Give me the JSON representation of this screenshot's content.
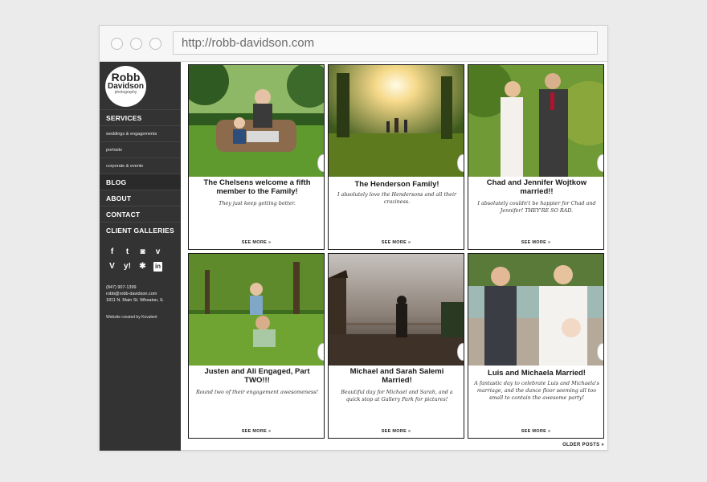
{
  "browser": {
    "url": "http://robb-davidson.com"
  },
  "logo": {
    "line1": "Robb",
    "line2": "Davidson",
    "line3": "photography"
  },
  "nav": {
    "services": "SERVICES",
    "sub1": "weddings & engagements",
    "sub2": "portraits",
    "sub3": "corporate & events",
    "blog": "BLOG",
    "about": "ABOUT",
    "contact": "CONTACT",
    "client": "CLIENT GALLERIES"
  },
  "social": {
    "icons": [
      "facebook-icon",
      "twitter-icon",
      "instagram-icon",
      "vimeo-icon",
      "vine-icon",
      "yelp-icon",
      "yelp-flower-icon",
      "linkedin-icon"
    ],
    "glyphs": {
      "facebook": "f",
      "twitter": "t",
      "instagram": "◙",
      "vimeo": "v",
      "vine": "V",
      "yelp": "y!",
      "flower": "✱",
      "linkedin": "in"
    }
  },
  "contact": {
    "phone": "(847) 907-1399",
    "email": "robb@robb-davidson.com",
    "address": "1811 N. Main St. Wheaton, IL",
    "credit": "Website created by Kovalent"
  },
  "posts": [
    {
      "title": "The Chelsens welcome a fifth member to the Family!",
      "excerpt": "They just keep getting better.",
      "more": "SEE MORE »"
    },
    {
      "title": "The Henderson Family!",
      "excerpt": "I absolutely love the Hendersons and all their craziness.",
      "more": "SEE MORE »"
    },
    {
      "title": "Chad and Jennifer Wojtkow married!!",
      "excerpt": "I absolutely couldn't be happier for Chad and Jennifer! THEY'RE SO RAD.",
      "more": "SEE MORE »"
    },
    {
      "title": "Justen and Ali Engaged, Part TWO!!!",
      "excerpt": "Round two of their engagement awesomeness!",
      "more": "SEE MORE »"
    },
    {
      "title": "Michael and Sarah Salemi Married!",
      "excerpt": "Beautiful day for Michael and Sarah, and a quick stop at Gallery Park for pictures!",
      "more": "SEE MORE »"
    },
    {
      "title": "Luis and Michaela Married!",
      "excerpt": "A fantastic day to celebrate Luis and Michaela's marriage, and the dance floor seeming all too small to contain the awesome party!",
      "more": "SEE MORE »"
    }
  ],
  "pagination": {
    "older": "OLDER POSTS »"
  }
}
